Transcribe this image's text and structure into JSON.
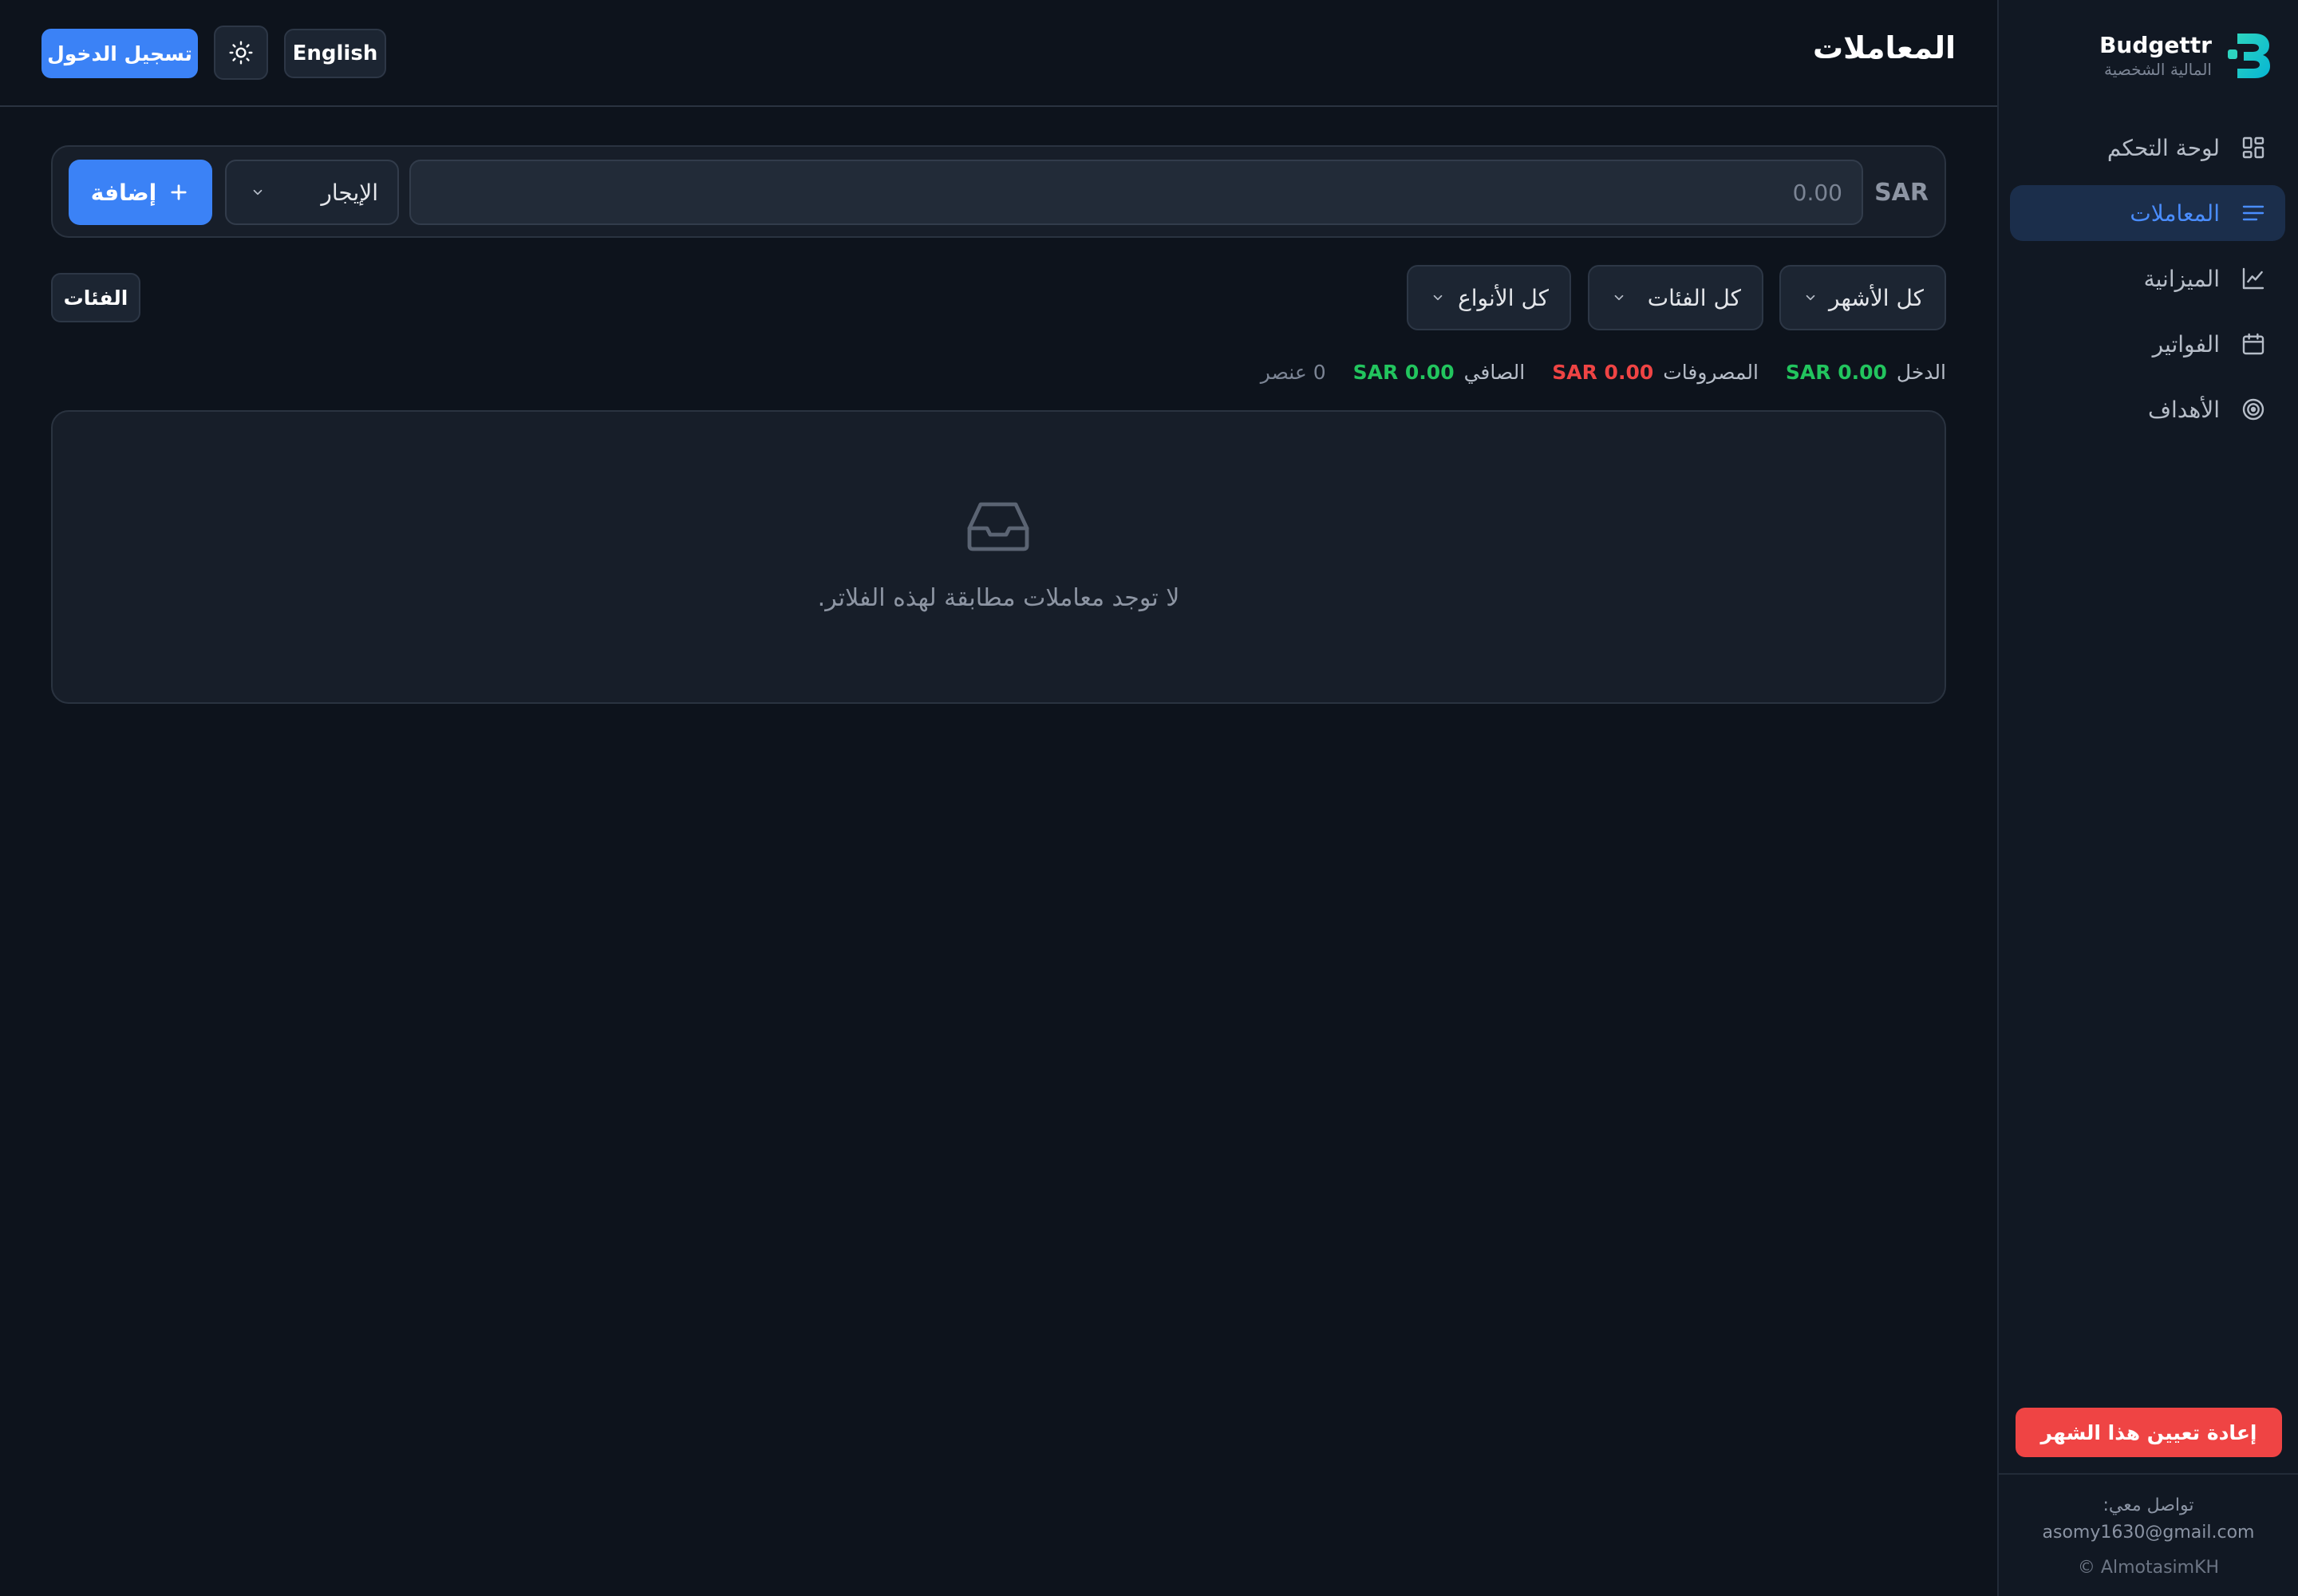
{
  "app": {
    "name": "Budgettr",
    "tagline": "المالية الشخصية"
  },
  "sidebar": {
    "items": [
      {
        "label": "لوحة التحكم",
        "icon": "dashboard-icon",
        "active": false
      },
      {
        "label": "المعاملات",
        "icon": "list-icon",
        "active": true
      },
      {
        "label": "الميزانية",
        "icon": "chart-line-icon",
        "active": false
      },
      {
        "label": "الفواتير",
        "icon": "calendar-icon",
        "active": false
      },
      {
        "label": "الأهداف",
        "icon": "target-icon",
        "active": false
      }
    ],
    "reset_label": "إعادة تعيين هذا الشهر",
    "contact_label": "تواصل معي:",
    "contact_email": "asomy1630@gmail.com",
    "copyright": "© AlmotasimKH"
  },
  "header": {
    "title": "المعاملات",
    "language_label": "English",
    "theme_icon": "sun-icon",
    "login_label": "تسجيل الدخول"
  },
  "add_form": {
    "currency": "SAR",
    "amount_placeholder": "0.00",
    "category_value": "الإيجار",
    "add_label": "إضافة"
  },
  "filters": {
    "months": "كل الأشهر",
    "categories": "كل الفئات",
    "types": "كل الأنواع",
    "categories_button": "الفئات"
  },
  "summary": {
    "income_label": "الدخل",
    "income_value": "SAR 0.00",
    "expenses_label": "المصروفات",
    "expenses_value": "SAR 0.00",
    "net_label": "الصافي",
    "net_value": "SAR 0.00",
    "count": "0 عنصر"
  },
  "empty_state": {
    "icon": "inbox-icon",
    "message": "لا توجد معاملات مطابقة لهذه الفلاتر."
  },
  "colors": {
    "accent": "#3b82f6",
    "income": "#22c55e",
    "expense": "#ef4444",
    "background": "#0d131c",
    "sidebar": "#111823"
  }
}
